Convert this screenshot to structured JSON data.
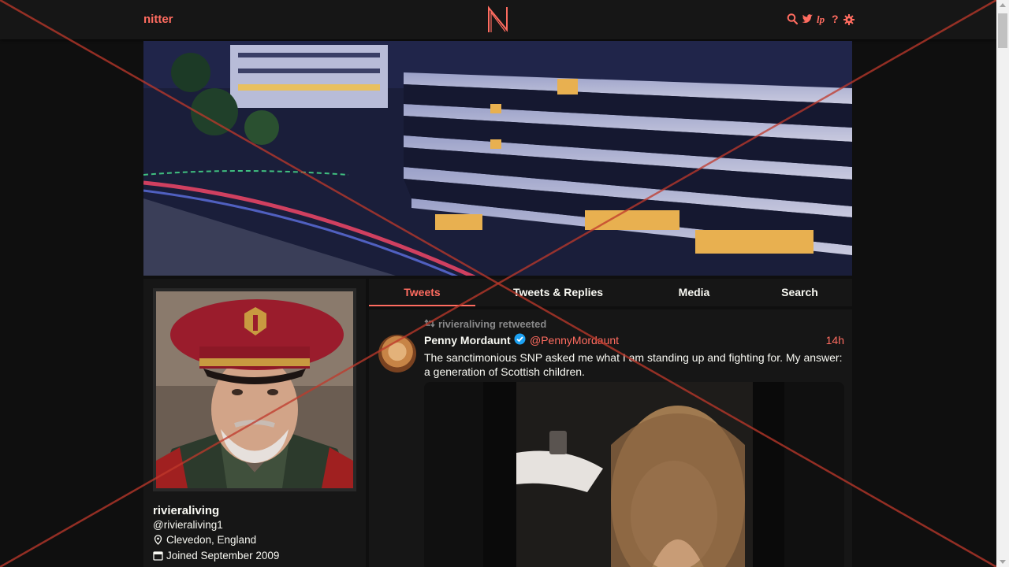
{
  "navbar": {
    "brand": "nitter",
    "logo_letter": "N",
    "icons": [
      "search-icon",
      "twitter-icon",
      "rss-icon",
      "help-icon",
      "settings-icon"
    ],
    "accent_color": "#ff6c60"
  },
  "profile": {
    "fullname": "rivieraliving",
    "username": "@rivieraliving1",
    "location": "Clevedon, England",
    "joined": "Joined September 2009"
  },
  "tabs": [
    {
      "label": "Tweets",
      "active": true
    },
    {
      "label": "Tweets & Replies",
      "active": false
    },
    {
      "label": "Media",
      "active": false
    },
    {
      "label": "Search",
      "active": false
    }
  ],
  "tweet": {
    "retweet_header": "rivieraliving retweeted",
    "fullname": "Penny Mordaunt",
    "verified": true,
    "username": "@PennyMordaunt",
    "time": "14h",
    "text": "The sanctimonious SNP asked me what I am standing up and fighting for. My answer: a generation of Scottish children."
  },
  "colors": {
    "background": "#0f0f0f",
    "panel": "#161616",
    "text": "#f8f8f2",
    "accent": "#ff6c60",
    "muted": "#888889",
    "overlay_cross": "#c0392b"
  }
}
